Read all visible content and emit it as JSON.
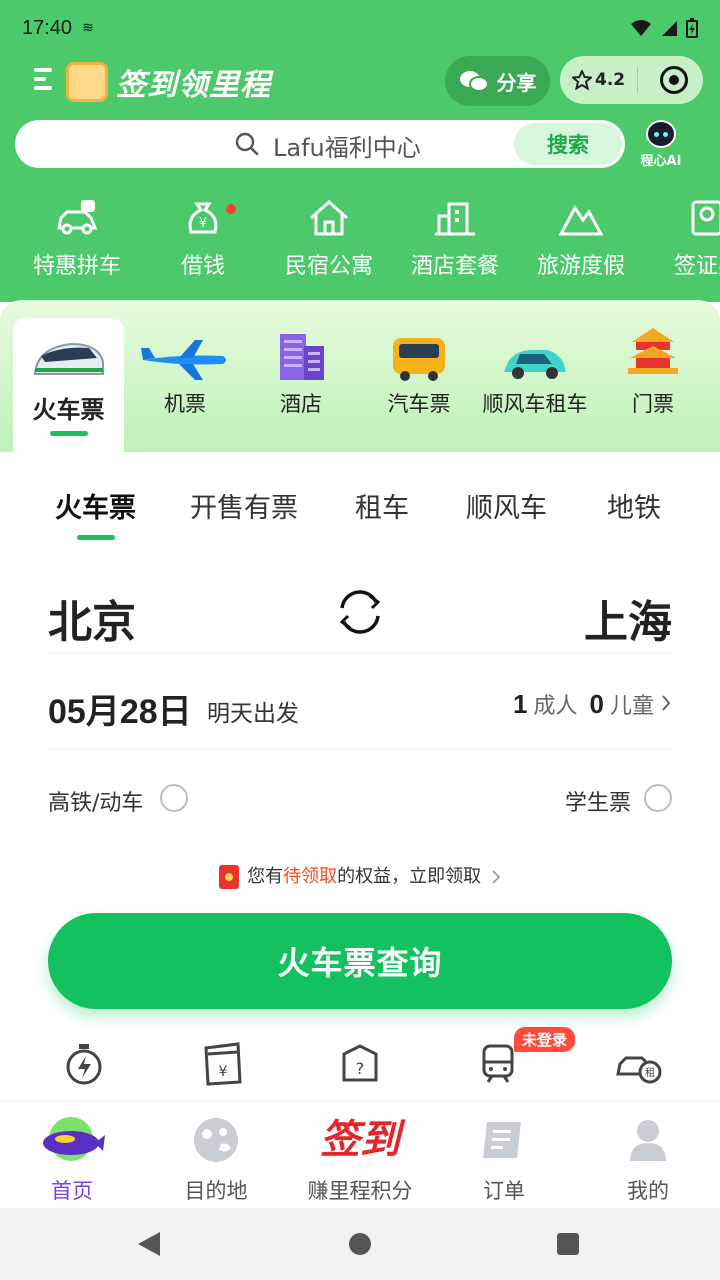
{
  "status_bar": {
    "time": "17:40"
  },
  "header": {
    "title": "签到领里程",
    "share_label": "分享",
    "rating": "4.2"
  },
  "search": {
    "placeholder": "Lafu福利中心",
    "button_label": "搜索",
    "ai_label": "程心AI"
  },
  "quick_services": [
    {
      "label": "特惠拼车",
      "icon": "car-pool-icon"
    },
    {
      "label": "借钱",
      "icon": "money-bag-icon"
    },
    {
      "label": "民宿公寓",
      "icon": "house-icon"
    },
    {
      "label": "酒店套餐",
      "icon": "hotel-building-icon"
    },
    {
      "label": "旅游度假",
      "icon": "mountain-icon"
    },
    {
      "label": "签证办",
      "icon": "passport-icon"
    }
  ],
  "transport_tabs": [
    {
      "label": "火车票",
      "icon": "train-icon",
      "active": true
    },
    {
      "label": "机票",
      "icon": "plane-icon"
    },
    {
      "label": "酒店",
      "icon": "hotel-icon"
    },
    {
      "label": "汽车票",
      "icon": "bus-icon"
    },
    {
      "label": "顺风车租车",
      "icon": "car-icon"
    },
    {
      "label": "门票",
      "icon": "temple-icon"
    }
  ],
  "sub_tabs": [
    {
      "label": "火车票",
      "active": true
    },
    {
      "label": "开售有票"
    },
    {
      "label": "租车"
    },
    {
      "label": "顺风车"
    },
    {
      "label": "地铁"
    }
  ],
  "form": {
    "from_city": "北京",
    "to_city": "上海",
    "date": "05月28日",
    "date_note": "明天出发",
    "adult_count": "1",
    "adult_label": "成人",
    "child_count": "0",
    "child_label": "儿童",
    "option_highspeed": "高铁/动车",
    "option_student": "学生票"
  },
  "promo": {
    "prefix": "您有",
    "highlight": "待领取",
    "suffix": "的权益，立即领取"
  },
  "search_train_button": "火车票查询",
  "mini_shortcuts": [
    {
      "icon": "stopwatch-icon"
    },
    {
      "icon": "yen-envelope-icon"
    },
    {
      "icon": "question-box-icon"
    },
    {
      "icon": "train-front-icon",
      "badge": "未登录"
    },
    {
      "icon": "car-rent-icon"
    }
  ],
  "bottom_nav": [
    {
      "label": "首页",
      "icon": "home-blimp-icon",
      "active": true
    },
    {
      "label": "目的地",
      "icon": "destination-icon"
    },
    {
      "label": "赚里程积分",
      "icon": "checkin-icon",
      "icon_text": "签到"
    },
    {
      "label": "订单",
      "icon": "order-icon"
    },
    {
      "label": "我的",
      "icon": "profile-icon"
    }
  ],
  "colors": {
    "brand_green": "#4cc96a",
    "button_green": "#13c15f",
    "active_purple": "#7b3fe4",
    "badge_red": "#ff4b3a"
  }
}
